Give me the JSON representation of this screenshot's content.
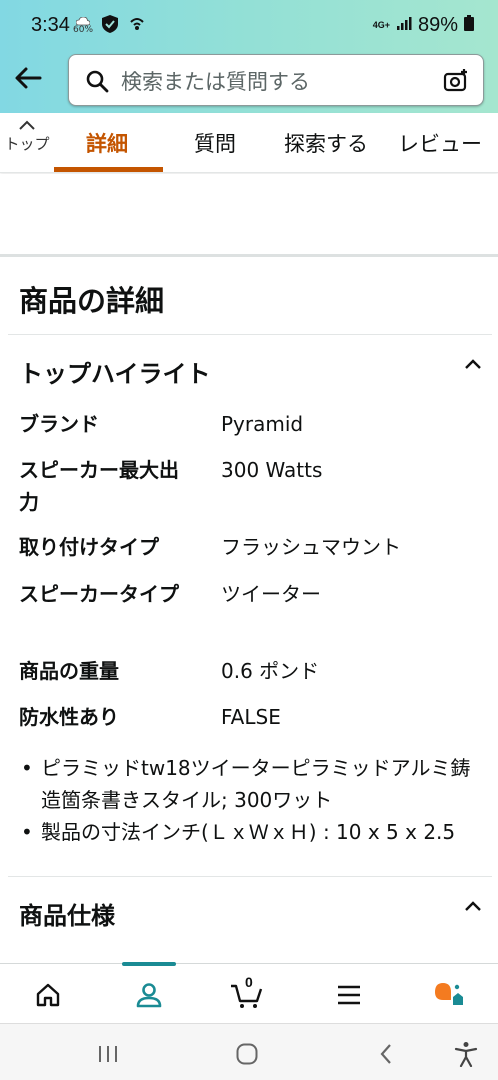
{
  "status_bar": {
    "time": "3:34",
    "weather_percent": "60%",
    "network": "4G+",
    "battery": "89%"
  },
  "search": {
    "placeholder": "検索または質問する"
  },
  "tabs": {
    "top_label": "トップ",
    "items": [
      {
        "label": "詳細",
        "active": true
      },
      {
        "label": "質問",
        "active": false
      },
      {
        "label": "探索する",
        "active": false
      },
      {
        "label": "レビュー",
        "active": false
      }
    ]
  },
  "section": {
    "title": "商品の詳細"
  },
  "highlights": {
    "heading": "トップハイライト",
    "rows": [
      {
        "label": "ブランド",
        "value": "Pyramid"
      },
      {
        "label": "スピーカー最大出力",
        "value": "300 Watts"
      },
      {
        "label": "取り付けタイプ",
        "value": "フラッシュマウント"
      },
      {
        "label": "スピーカータイプ",
        "value": "ツイーター"
      },
      {
        "label": "商品の重量",
        "value": "0.6 ポンド"
      },
      {
        "label": "防水性あり",
        "value": "FALSE"
      }
    ],
    "bullets": [
      "ピラミッドtw18ツイーターピラミッドアルミ鋳造箇条書きスタイル; 300ワット",
      "製品の寸法インチ(ＬｘＷｘＨ) : 10 x 5 x 2.5"
    ]
  },
  "specs": {
    "heading": "商品仕様"
  },
  "bottom_nav": {
    "cart_count": "0",
    "items": [
      "home-icon",
      "account-icon",
      "cart-icon",
      "menu-icon",
      "rufus-icon"
    ]
  },
  "colors": {
    "header_gradient_start": "#82d8e3",
    "header_gradient_end": "#a5e6cf",
    "active_tab": "#c45500",
    "nav_indicator": "#1a8b94",
    "rufus_orange": "#f47b20",
    "rufus_teal": "#1a8b94"
  }
}
